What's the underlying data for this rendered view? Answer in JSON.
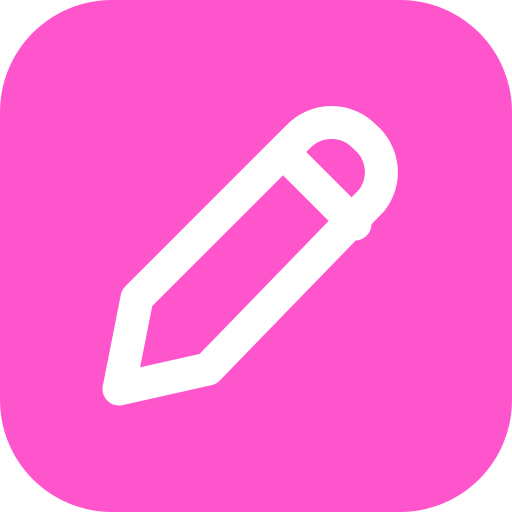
{
  "app_icon": {
    "icon": "pencil-icon",
    "background_color": "#ff55cc",
    "foreground_color": "#ffffff"
  }
}
